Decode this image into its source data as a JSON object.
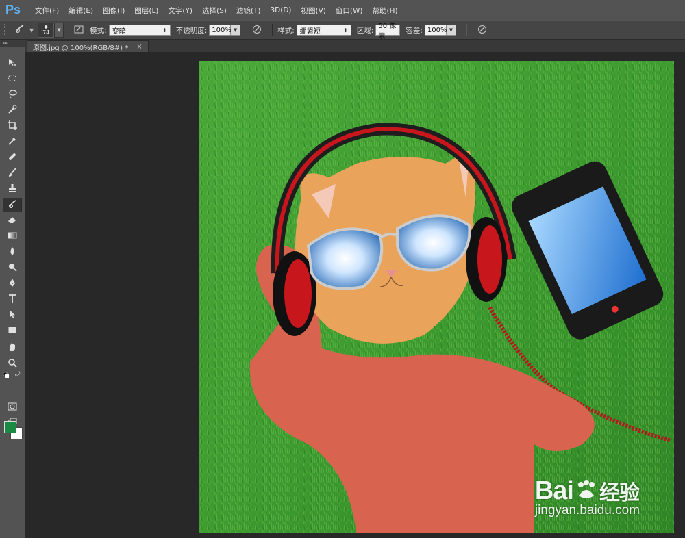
{
  "app": {
    "logo": "Ps"
  },
  "menu": [
    "文件(F)",
    "编辑(E)",
    "图像(I)",
    "图层(L)",
    "文字(Y)",
    "选择(S)",
    "滤镜(T)",
    "3D(D)",
    "视图(V)",
    "窗口(W)",
    "帮助(H)"
  ],
  "options": {
    "brush_size": "74",
    "mode_label": "模式:",
    "mode_value": "变暗",
    "opacity_label": "不透明度:",
    "opacity_value": "100%",
    "style_label": "样式:",
    "style_value": "绷紧短",
    "area_label": "区域:",
    "area_value": "50 像素",
    "tolerance_label": "容差:",
    "tolerance_value": "100%"
  },
  "document": {
    "tab_title": "原图.jpg @ 100%(RGB/8#) *",
    "close": "×"
  },
  "tools": [
    {
      "name": "move-tool",
      "icon": "move-icon"
    },
    {
      "name": "marquee-tool",
      "icon": "ellipse-marquee-icon"
    },
    {
      "name": "lasso-tool",
      "icon": "lasso-icon"
    },
    {
      "name": "quick-select-tool",
      "icon": "quick-select-icon"
    },
    {
      "name": "crop-tool",
      "icon": "crop-icon"
    },
    {
      "name": "eyedropper-tool",
      "icon": "eyedropper-icon"
    },
    {
      "name": "healing-tool",
      "icon": "bandage-icon"
    },
    {
      "name": "brush-tool",
      "icon": "brush-icon"
    },
    {
      "name": "stamp-tool",
      "icon": "stamp-icon"
    },
    {
      "name": "history-brush-tool",
      "icon": "art-history-brush-icon"
    },
    {
      "name": "eraser-tool",
      "icon": "eraser-icon"
    },
    {
      "name": "gradient-tool",
      "icon": "gradient-icon"
    },
    {
      "name": "blur-tool",
      "icon": "drop-icon"
    },
    {
      "name": "dodge-tool",
      "icon": "dodge-icon"
    },
    {
      "name": "pen-tool",
      "icon": "pen-icon"
    },
    {
      "name": "type-tool",
      "icon": "type-icon"
    },
    {
      "name": "path-select-tool",
      "icon": "arrow-icon"
    },
    {
      "name": "shape-tool",
      "icon": "rectangle-icon"
    },
    {
      "name": "hand-tool",
      "icon": "hand-icon"
    },
    {
      "name": "zoom-tool",
      "icon": "zoom-icon"
    }
  ],
  "colors": {
    "foreground": "#1a8a44",
    "background": "#ffffff",
    "ps_blue": "#5fb3f2"
  },
  "watermark": {
    "brand": "Bai",
    "brand_suffix": "经验",
    "url": "jingyan.baidu.com"
  }
}
